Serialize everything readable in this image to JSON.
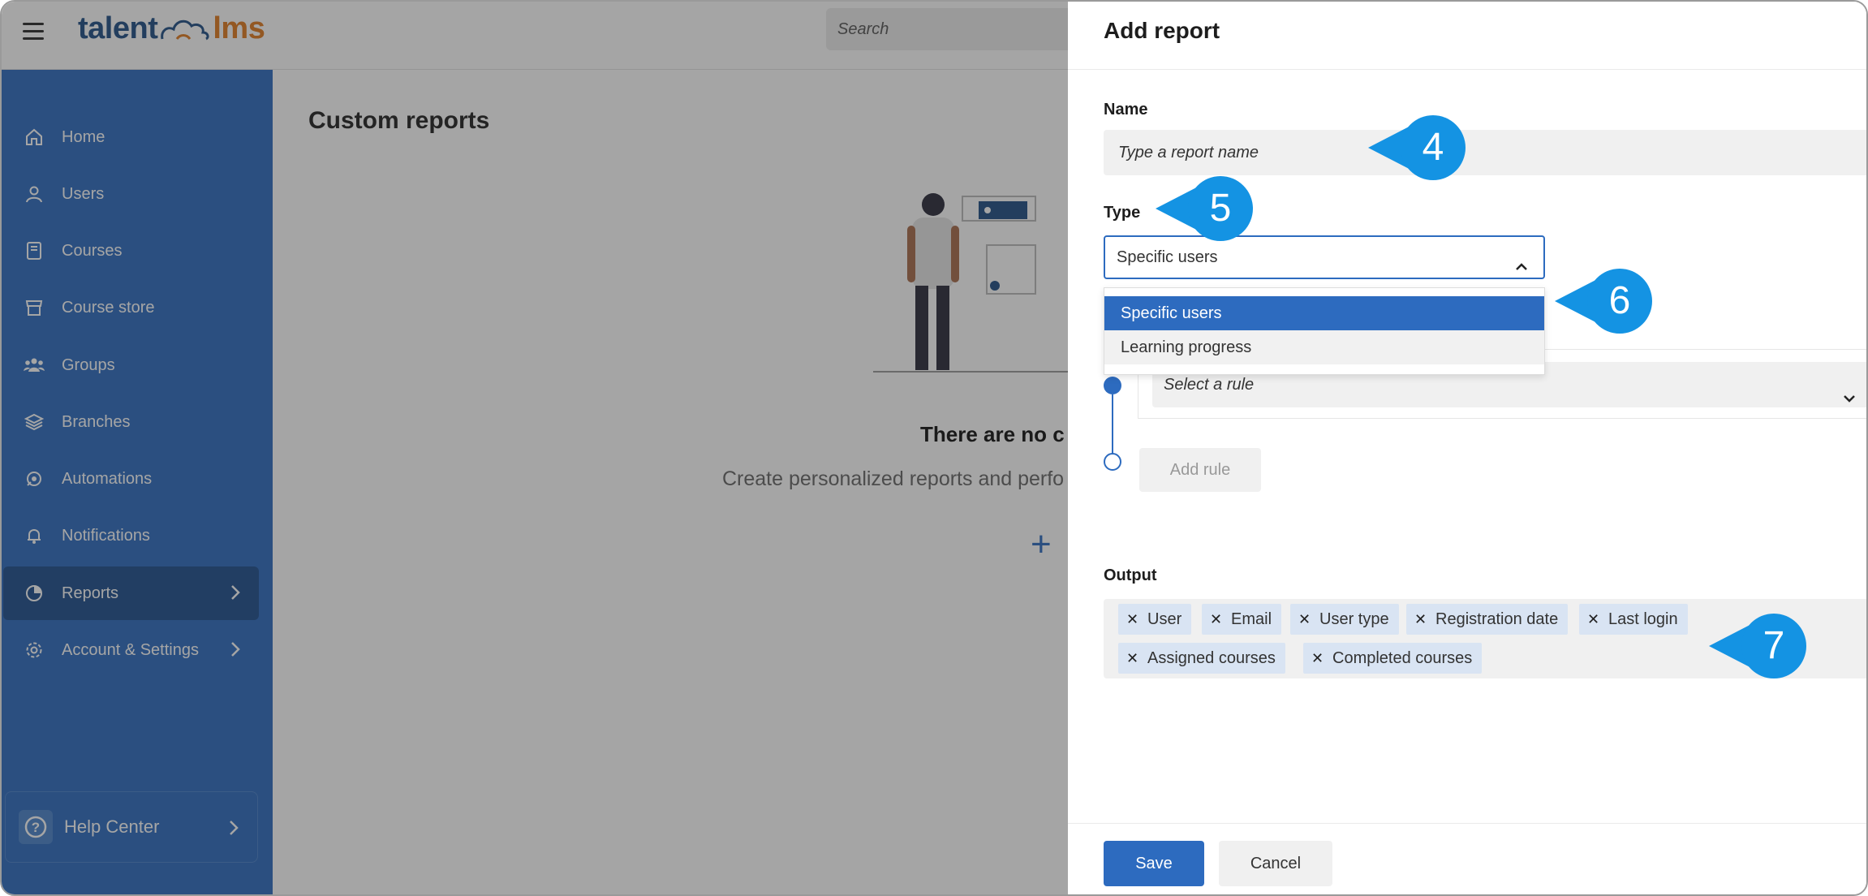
{
  "app": {
    "logo_left": "talent",
    "logo_right": "lms"
  },
  "search": {
    "placeholder": "Search"
  },
  "sidebar": {
    "items": [
      {
        "label": "Home",
        "icon": "home-icon"
      },
      {
        "label": "Users",
        "icon": "user-icon"
      },
      {
        "label": "Courses",
        "icon": "book-icon"
      },
      {
        "label": "Course store",
        "icon": "store-icon"
      },
      {
        "label": "Groups",
        "icon": "groups-icon"
      },
      {
        "label": "Branches",
        "icon": "layers-icon"
      },
      {
        "label": "Automations",
        "icon": "automation-icon"
      },
      {
        "label": "Notifications",
        "icon": "bell-icon"
      },
      {
        "label": "Reports",
        "icon": "pie-chart-icon",
        "active": true
      },
      {
        "label": "Account & Settings",
        "icon": "gear-icon"
      }
    ],
    "help": {
      "label": "Help Center"
    }
  },
  "main": {
    "title": "Custom reports",
    "empty_title": "There are no c",
    "empty_subtitle": "Create personalized reports and perfo",
    "plus": "+"
  },
  "panel": {
    "title": "Add report",
    "name_label": "Name",
    "name_placeholder": "Type a report name",
    "type_label": "Type",
    "type_value": "Specific users",
    "type_options": [
      "Specific users",
      "Learning progress"
    ],
    "rule_placeholder": "Select a rule",
    "add_rule": "Add rule",
    "output_label": "Output",
    "output_chips": [
      "User",
      "Email",
      "User type",
      "Registration date",
      "Last login",
      "Assigned courses",
      "Completed courses"
    ],
    "save": "Save",
    "cancel": "Cancel"
  },
  "callouts": [
    "4",
    "5",
    "6",
    "7"
  ],
  "colors": {
    "brand_blue": "#2d6bbf",
    "sidebar_active": "#1e4f8e",
    "callout": "#1493e3",
    "logo_orange": "#e07a1f"
  }
}
